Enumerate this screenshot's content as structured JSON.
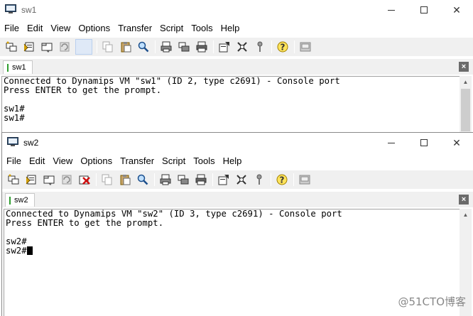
{
  "windows": [
    {
      "title": "sw1",
      "menu": [
        "File",
        "Edit",
        "View",
        "Options",
        "Transfer",
        "Script",
        "Tools",
        "Help"
      ],
      "tab": "sw1",
      "terminal_lines": [
        "Connected to Dynamips VM \"sw1\" (ID 2, type c2691) - Console port",
        "Press ENTER to get the prompt.",
        "",
        "sw1#",
        "sw1#"
      ]
    },
    {
      "title": "sw2",
      "menu": [
        "File",
        "Edit",
        "View",
        "Options",
        "Transfer",
        "Script",
        "Tools",
        "Help"
      ],
      "tab": "sw2",
      "terminal_lines": [
        "Connected to Dynamips VM \"sw2\" (ID 3, type c2691) - Console port",
        "Press ENTER to get the prompt.",
        "",
        "sw2#",
        "sw2#"
      ]
    }
  ],
  "toolbar_icons": [
    "connect-icon",
    "quick-connect-icon",
    "connect-in-tab-icon",
    "reconnect-icon",
    "disconnect-icon",
    "copy-icon",
    "paste-icon",
    "find-icon",
    "print-setup-icon",
    "print-preview-icon",
    "print-icon",
    "session-options-icon",
    "global-options-icon",
    "keymap-icon",
    "help-icon",
    "sftp-icon"
  ],
  "watermark": "@51CTO博客",
  "colors": {
    "tab_marker": "#2e9d2e",
    "cursor": "#000000"
  }
}
